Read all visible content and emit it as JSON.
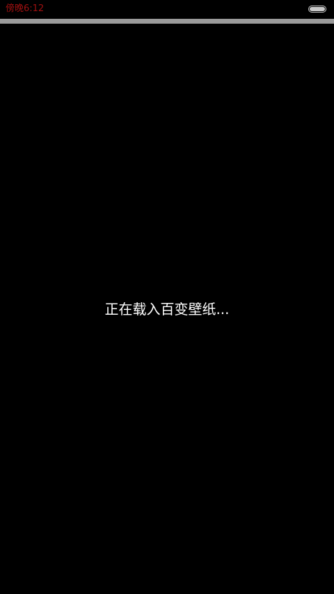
{
  "status_bar": {
    "time": "傍晚6:12",
    "time_color": "#a01010",
    "battery_icon": "battery-icon"
  },
  "main": {
    "loading_text": "正在载入百变壁纸..."
  },
  "colors": {
    "background": "#000000",
    "header_bar": "#9a9a9a",
    "text": "#ffffff"
  }
}
